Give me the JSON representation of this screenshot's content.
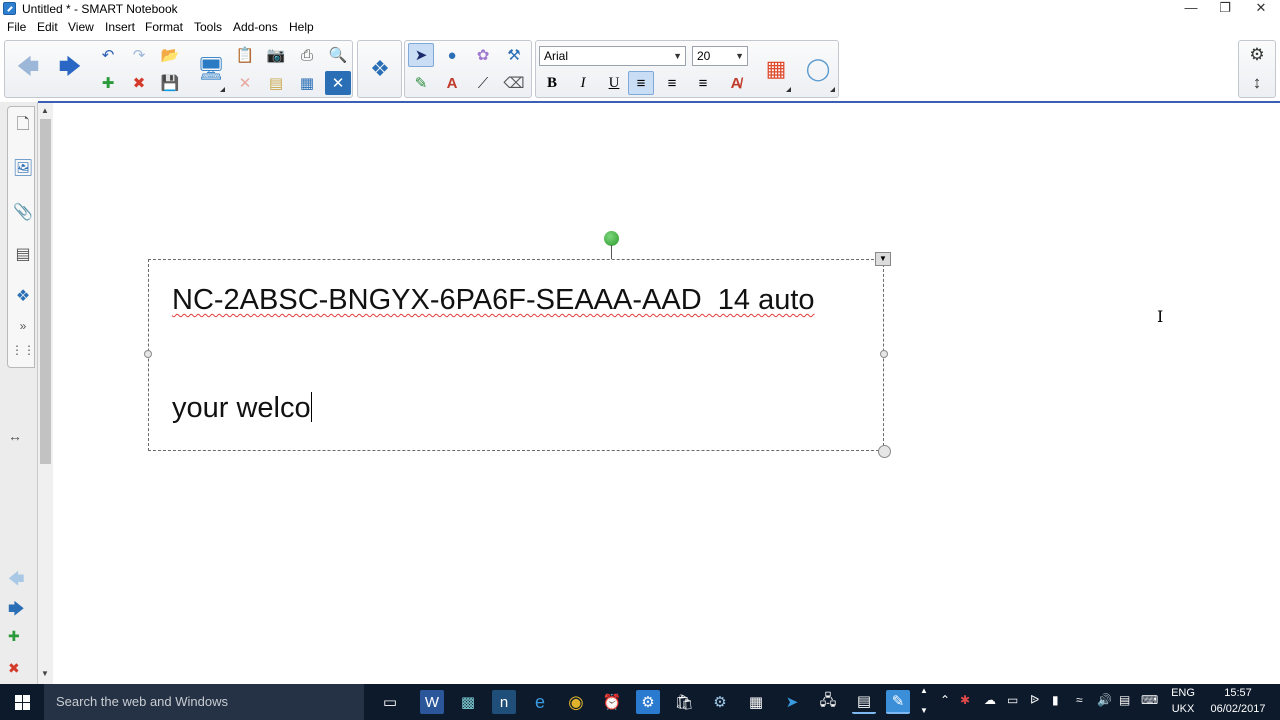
{
  "window": {
    "title": "Untitled * - SMART Notebook"
  },
  "menu": [
    "File",
    "Edit",
    "View",
    "Insert",
    "Format",
    "Tools",
    "Add-ons",
    "Help"
  ],
  "toolbar": {
    "font_name": "Arial",
    "font_size": "20",
    "bold_label": "B",
    "italic_label": "I",
    "underline_label": "U"
  },
  "textbox": {
    "line1": "NC-2ABSC-BNGYX-6PA6F-SEAAA-AAD  14 auto",
    "line2": "your welco"
  },
  "taskbar": {
    "search_placeholder": "Search the web and Windows",
    "language": "ENG",
    "layout": "UKX",
    "time": "15:57",
    "date": "06/02/2017"
  },
  "colors": {
    "accent": "#3a5fb4",
    "taskbar": "#0d1a2b",
    "selection": "#c9def5"
  }
}
